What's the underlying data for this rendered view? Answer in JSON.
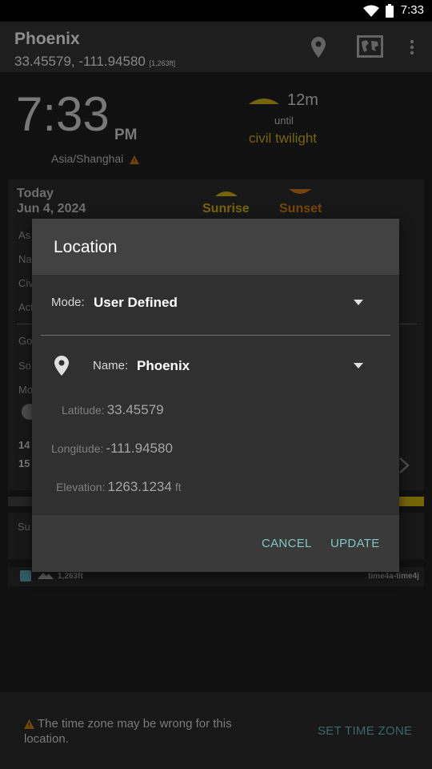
{
  "status_bar": {
    "time": "7:33"
  },
  "app_bar": {
    "title": "Phoenix",
    "coordinates": "33.45579, -111.94580",
    "elevation_small": "[1,263ft]"
  },
  "clock": {
    "time": "7:33",
    "ampm": "PM",
    "timezone": "Asia/Shanghai"
  },
  "twilight": {
    "minutes": "12m",
    "until": "until",
    "name": "civil twilight"
  },
  "card": {
    "today": "Today",
    "date": "Jun 4, 2024",
    "sunrise": "Sunrise",
    "sunset": "Sunset",
    "rows": [
      "As",
      "Na",
      "Civ",
      "Act",
      "Go",
      "So",
      "Mo",
      "14",
      "15"
    ]
  },
  "card2": {
    "label": "Su"
  },
  "footer_strip": {
    "elevation": "1,263ft",
    "tag": "time4a-time4j"
  },
  "dialog": {
    "title": "Location",
    "mode_label": "Mode:",
    "mode_value": "User Defined",
    "name_label": "Name:",
    "name_value": "Phoenix",
    "latitude_label": "Latitude:",
    "latitude_value": "33.45579",
    "longitude_label": "Longitude:",
    "longitude_value": "-111.94580",
    "elevation_label": "Elevation:",
    "elevation_value": "1263.1234",
    "elevation_unit": "ft",
    "cancel": "CANCEL",
    "update": "UPDATE"
  },
  "banner": {
    "message": "The time zone may be wrong for this location.",
    "action": "SET TIME ZONE"
  },
  "colors": {
    "accent": "#7fc6c2",
    "sun": "#b59a12",
    "sunset": "#b36a12"
  }
}
